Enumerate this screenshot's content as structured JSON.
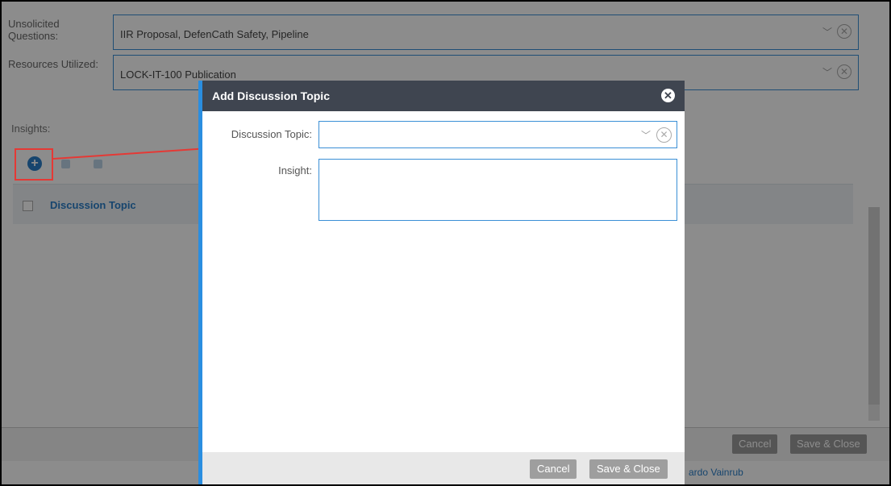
{
  "background_form": {
    "fields": [
      {
        "label": "Unsolicited Questions:",
        "value": "IIR Proposal, DefenCath Safety, Pipeline"
      },
      {
        "label": "Resources Utilized:",
        "value": "LOCK-IT-100 Publication"
      }
    ],
    "insights_label": "Insights:",
    "grid_column": "Discussion Topic",
    "footer": {
      "cancel_label": "Cancel",
      "save_label": "Save & Close"
    },
    "peek_text": "ardo Vainrub"
  },
  "icons": {
    "chevron": "chevron-down-icon",
    "clear": "clear-circle-icon",
    "add": "plus-circle-icon",
    "close": "close-circle-icon"
  },
  "modal": {
    "title": "Add Discussion Topic",
    "discussion_topic_label": "Discussion Topic:",
    "discussion_topic_value": "",
    "insight_label": "Insight:",
    "insight_value": "",
    "cancel_label": "Cancel",
    "save_label": "Save & Close"
  },
  "colors": {
    "accent": "#2a8ee0",
    "header": "#3f4550",
    "highlight": "#e53935"
  }
}
